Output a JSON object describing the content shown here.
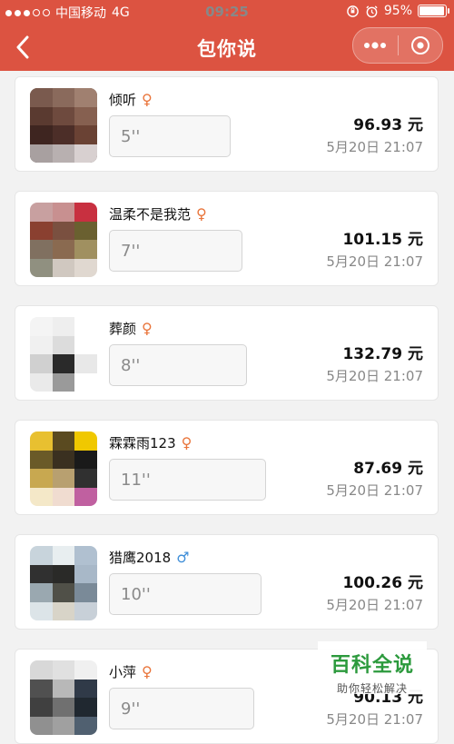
{
  "status_bar": {
    "carrier": "中国移动",
    "network": "4G",
    "time": "09:25",
    "battery": "95%",
    "battery_level": 0.95,
    "signal_bars_filled": 3,
    "signal_bars_total": 5
  },
  "nav": {
    "title": "包你说",
    "back_icon": "chevron-left-icon",
    "menu_icon": "more-dots-icon",
    "close_icon": "target-circle-icon"
  },
  "colors": {
    "header": "#dc5341",
    "female": "#e9743a",
    "male": "#3f8ed8",
    "watermark": "#2c9a3d"
  },
  "records": [
    {
      "name": "倾听",
      "gender": "female",
      "duration": "5''",
      "amount": "96.93 元",
      "time": "5月20日 21:07"
    },
    {
      "name": "温柔不是我范",
      "gender": "female",
      "duration": "7''",
      "amount": "101.15 元",
      "time": "5月20日 21:07"
    },
    {
      "name": "葬颜",
      "gender": "female",
      "duration": "8''",
      "amount": "132.79 元",
      "time": "5月20日 21:07"
    },
    {
      "name": "霖霖雨123",
      "gender": "female",
      "duration": "11''",
      "amount": "87.69 元",
      "time": "5月20日 21:07"
    },
    {
      "name": "猎鹰2018",
      "gender": "male",
      "duration": "10''",
      "amount": "100.26 元",
      "time": "5月20日 21:07"
    },
    {
      "name": "小萍",
      "gender": "female",
      "duration": "9''",
      "amount": "90.13 元",
      "time": "5月20日 21:07"
    }
  ],
  "watermark": {
    "title": "百科全说",
    "subtitle": "助你轻松解决"
  }
}
